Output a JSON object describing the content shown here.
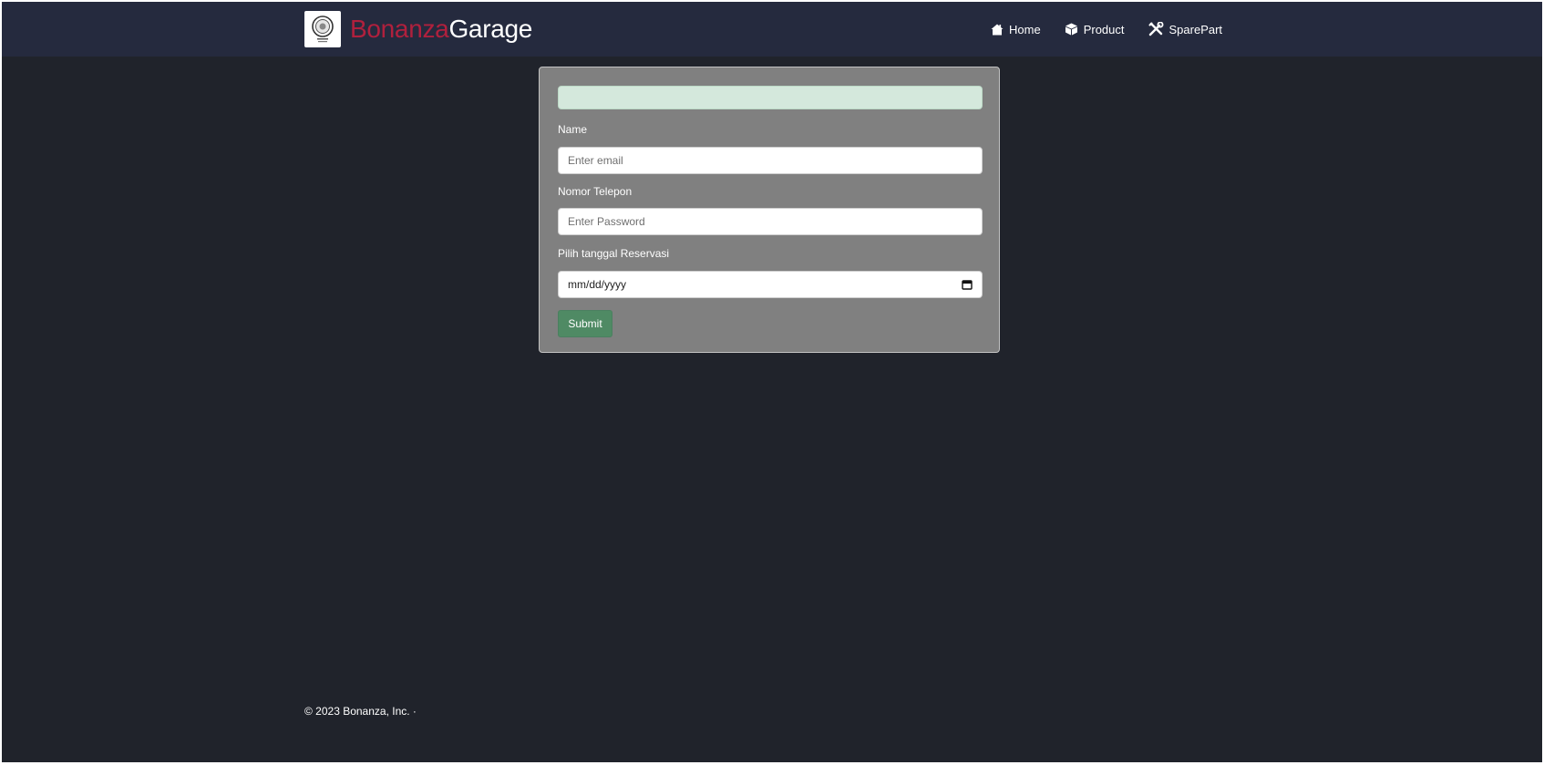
{
  "brand": {
    "name_part1": "Bonanza",
    "name_part2": "Garage",
    "logo_icon": "garage-seal-logo"
  },
  "nav": {
    "items": [
      {
        "label": "Home",
        "icon": "home-icon"
      },
      {
        "label": "Product",
        "icon": "box-icon"
      },
      {
        "label": "SparePart",
        "icon": "tools-icon"
      }
    ]
  },
  "form": {
    "name_label": "Name",
    "name_placeholder": "Enter email",
    "phone_label": "Nomor Telepon",
    "phone_placeholder": "Enter Password",
    "date_label": "Pilih tanggal Reservasi",
    "date_placeholder": "mm/dd/yyyy",
    "submit_label": "Submit"
  },
  "footer": {
    "text": "© 2023 Bonanza, Inc. ·"
  },
  "colors": {
    "background": "#20232b",
    "navbar": "#252a3e",
    "brand_accent": "#b0203d",
    "card": "#808080",
    "alert": "#d4e8dc",
    "submit": "#4f8a64"
  }
}
